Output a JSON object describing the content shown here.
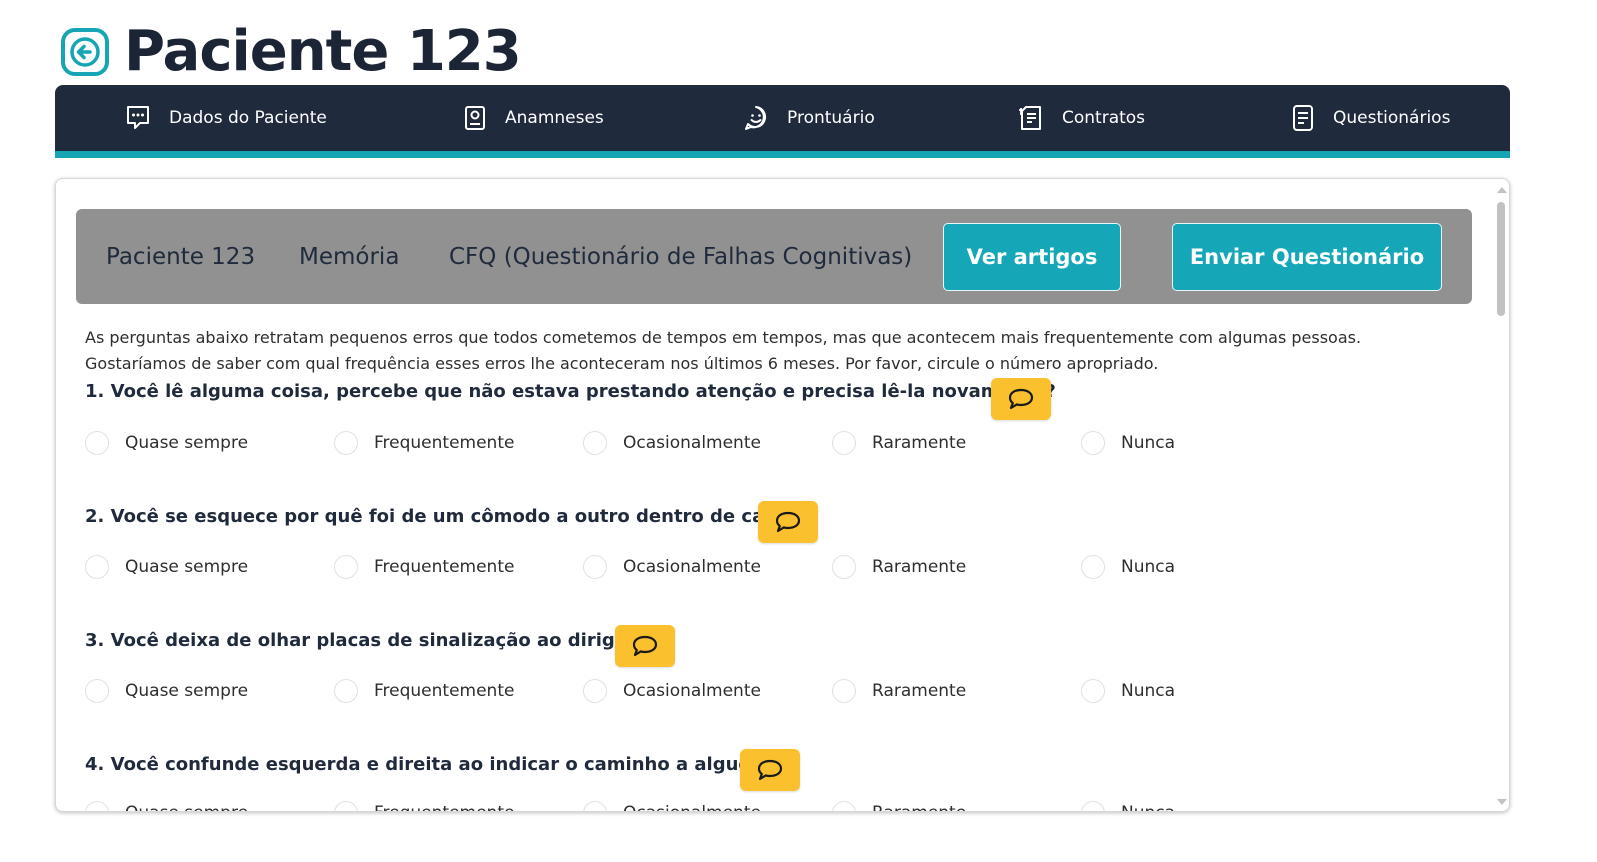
{
  "page": {
    "title": "Paciente 123"
  },
  "nav": {
    "items": [
      {
        "label": "Dados do Paciente",
        "icon": "chat-dots-icon"
      },
      {
        "label": "Anamneses",
        "icon": "user-card-icon"
      },
      {
        "label": "Prontuário",
        "icon": "chat-smile-icon"
      },
      {
        "label": "Contratos",
        "icon": "contract-icon"
      },
      {
        "label": "Questionários",
        "icon": "document-icon"
      }
    ]
  },
  "header": {
    "patient": "Paciente 123",
    "category": "Memória",
    "questionnaire": "CFQ (Questionário de Falhas Cognitivas)",
    "view_articles": "Ver artigos",
    "send": "Enviar Questionário"
  },
  "intro": "As perguntas abaixo retratam pequenos erros que todos cometemos de tempos em tempos, mas que acontecem mais frequentemente com algumas pessoas. Gostaríamos de saber com qual frequência esses erros lhe aconteceram nos últimos 6 meses. Por favor, circule o número apropriado.",
  "options": [
    "Quase sempre",
    "Frequentemente",
    "Ocasionalmente",
    "Raramente",
    "Nunca"
  ],
  "questions": [
    {
      "text": "1. Você lê alguma coisa, percebe que não estava prestando atenção e precisa lê-la novamente?"
    },
    {
      "text": "2. Você se esquece por quê foi de um cômodo a outro dentro de casa?"
    },
    {
      "text": "3. Você deixa de olhar placas de sinalização ao dirigir?"
    },
    {
      "text": "4. Você confunde esquerda e direita ao indicar o caminho a alguém?"
    }
  ],
  "colors": {
    "navy": "#1f2a3c",
    "teal": "#15a7b8",
    "yellow": "#fbc02d",
    "gray_header": "#919191"
  }
}
